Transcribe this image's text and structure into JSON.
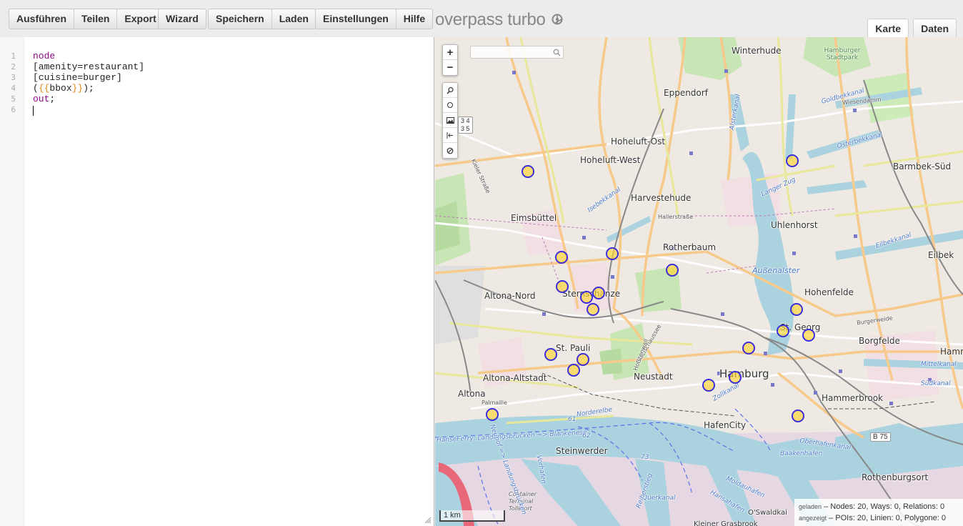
{
  "toolbar": {
    "run": "Ausführen",
    "share": "Teilen",
    "export": "Export",
    "wizard": "Wizard",
    "save": "Speichern",
    "load": "Laden",
    "settings": "Einstellungen",
    "help": "Hilfe"
  },
  "app": {
    "logo": "overpass turbo",
    "logo_icon": "settings-wheel-icon"
  },
  "tabs": {
    "map": "Karte",
    "data": "Daten"
  },
  "editor": {
    "line_numbers": [
      "1",
      "2",
      "3",
      "4",
      "5",
      "6"
    ],
    "lines": {
      "l1": "node",
      "l2": "[amenity=restaurant]",
      "l3": "[cuisine=burger]",
      "l4_open": "(",
      "l4_tmpl_open": "{{",
      "l4_word": "bbox",
      "l4_tmpl_close": "}}",
      "l4_close": ");",
      "l5_kw": "out",
      "l5_rest": ";"
    }
  },
  "map": {
    "zoom_in": "+",
    "zoom_out": "−",
    "tool_icons": [
      "zoom-to-data-icon",
      "locate-icon",
      "layers-icon",
      "fullscreen-icon",
      "clear-icon"
    ],
    "layer_badge": "3 4\n3 5",
    "scale": "1 km",
    "labels": {
      "winterhude": "Winterhude",
      "stadtpark": "Hamburger\nStadtpark",
      "eppendorf": "Eppendorf",
      "hoheluft_ost": "Hoheluft-Ost",
      "hoheluft_west": "Hoheluft-West",
      "barmbek": "Barmbek-Süd",
      "harvestehude": "Harvestehude",
      "eimsbuettel": "Eimsbüttel",
      "uhlenhorst": "Uhlenhorst",
      "rotherbaum": "Rotherbaum",
      "eilbek": "Eilbek",
      "altona_nord": "Altona-Nord",
      "sternschanze": "Sternschanze",
      "hohenfelde": "Hohenfelde",
      "st_georg": "St. Georg",
      "borgfelde": "Borgfelde",
      "st_pauli": "St. Pauli",
      "hamm": "Hamm",
      "altona_altstadt": "Altona-Altstadt",
      "neustadt": "Neustadt",
      "hamburg": "Hamburg",
      "hammerbrook": "Hammerbrook",
      "altona": "Altona",
      "hafencity": "HafenCity",
      "steinwerder": "Steinwerder",
      "rothenburgsort": "Rothenburgsort",
      "container": "Container\nTerminal\nTollerort",
      "kleiner": "Kleiner Grasbrook",
      "oswaldkai": "O'Swaldkai",
      "b75": "B 75",
      "kieler": "Kieler Straße",
      "hallerstr": "Hallerstraße",
      "wiesendamm": "Wiesendamm",
      "palmaille": "Palmaille",
      "goldbekkanal": "Goldbekkanal",
      "osterbekkanal": "Osterbekkanal",
      "isebekkanal": "Isebekkanal",
      "alsterkanal": "Alsterkanal",
      "langenzug": "Langer Zug",
      "aussenalster": "Außenalster",
      "eilbekkanal": "Eilbekkanal",
      "burgerweide": "Burgerweide",
      "suedkanal": "Südkanal",
      "mittelkanal": "Mittelkanal",
      "oberhafenkanal": "Oberhafenkanal",
      "baakenhafen": "Baakenhafen",
      "norderelbe": "Norderelbe",
      "hanseferry": "HanseFerry: Landungsbrücken => Blankenese",
      "zollkanal": "Zollkanal",
      "moldauhafen": "Moldauhafen",
      "hansahafen": "Hansahafen",
      "querkanal": "Querkanal",
      "reiherstieg": "Reiherstieg",
      "vorhafen": "Vorhafen",
      "neuhof": "Neuhof => Landungsbrücken",
      "glacischaussee": "Glacischaussee",
      "holstenwall": "Holstenwall",
      "route61": "61",
      "route62": "62",
      "route73": "73"
    },
    "stats": {
      "loaded_label": "geladen",
      "loaded": "– Nodes: 20, Ways: 0, Relations: 0",
      "shown_label": "angezeigt",
      "shown": "– POIs: 20, Linien: 0, Polygone: 0"
    }
  },
  "colors": {
    "keyword": "#8a0a86",
    "bracket": "#e08a1a",
    "poi_stroke": "#3b2edb",
    "poi_fill": "#ffd633",
    "water": "#aad3df"
  }
}
